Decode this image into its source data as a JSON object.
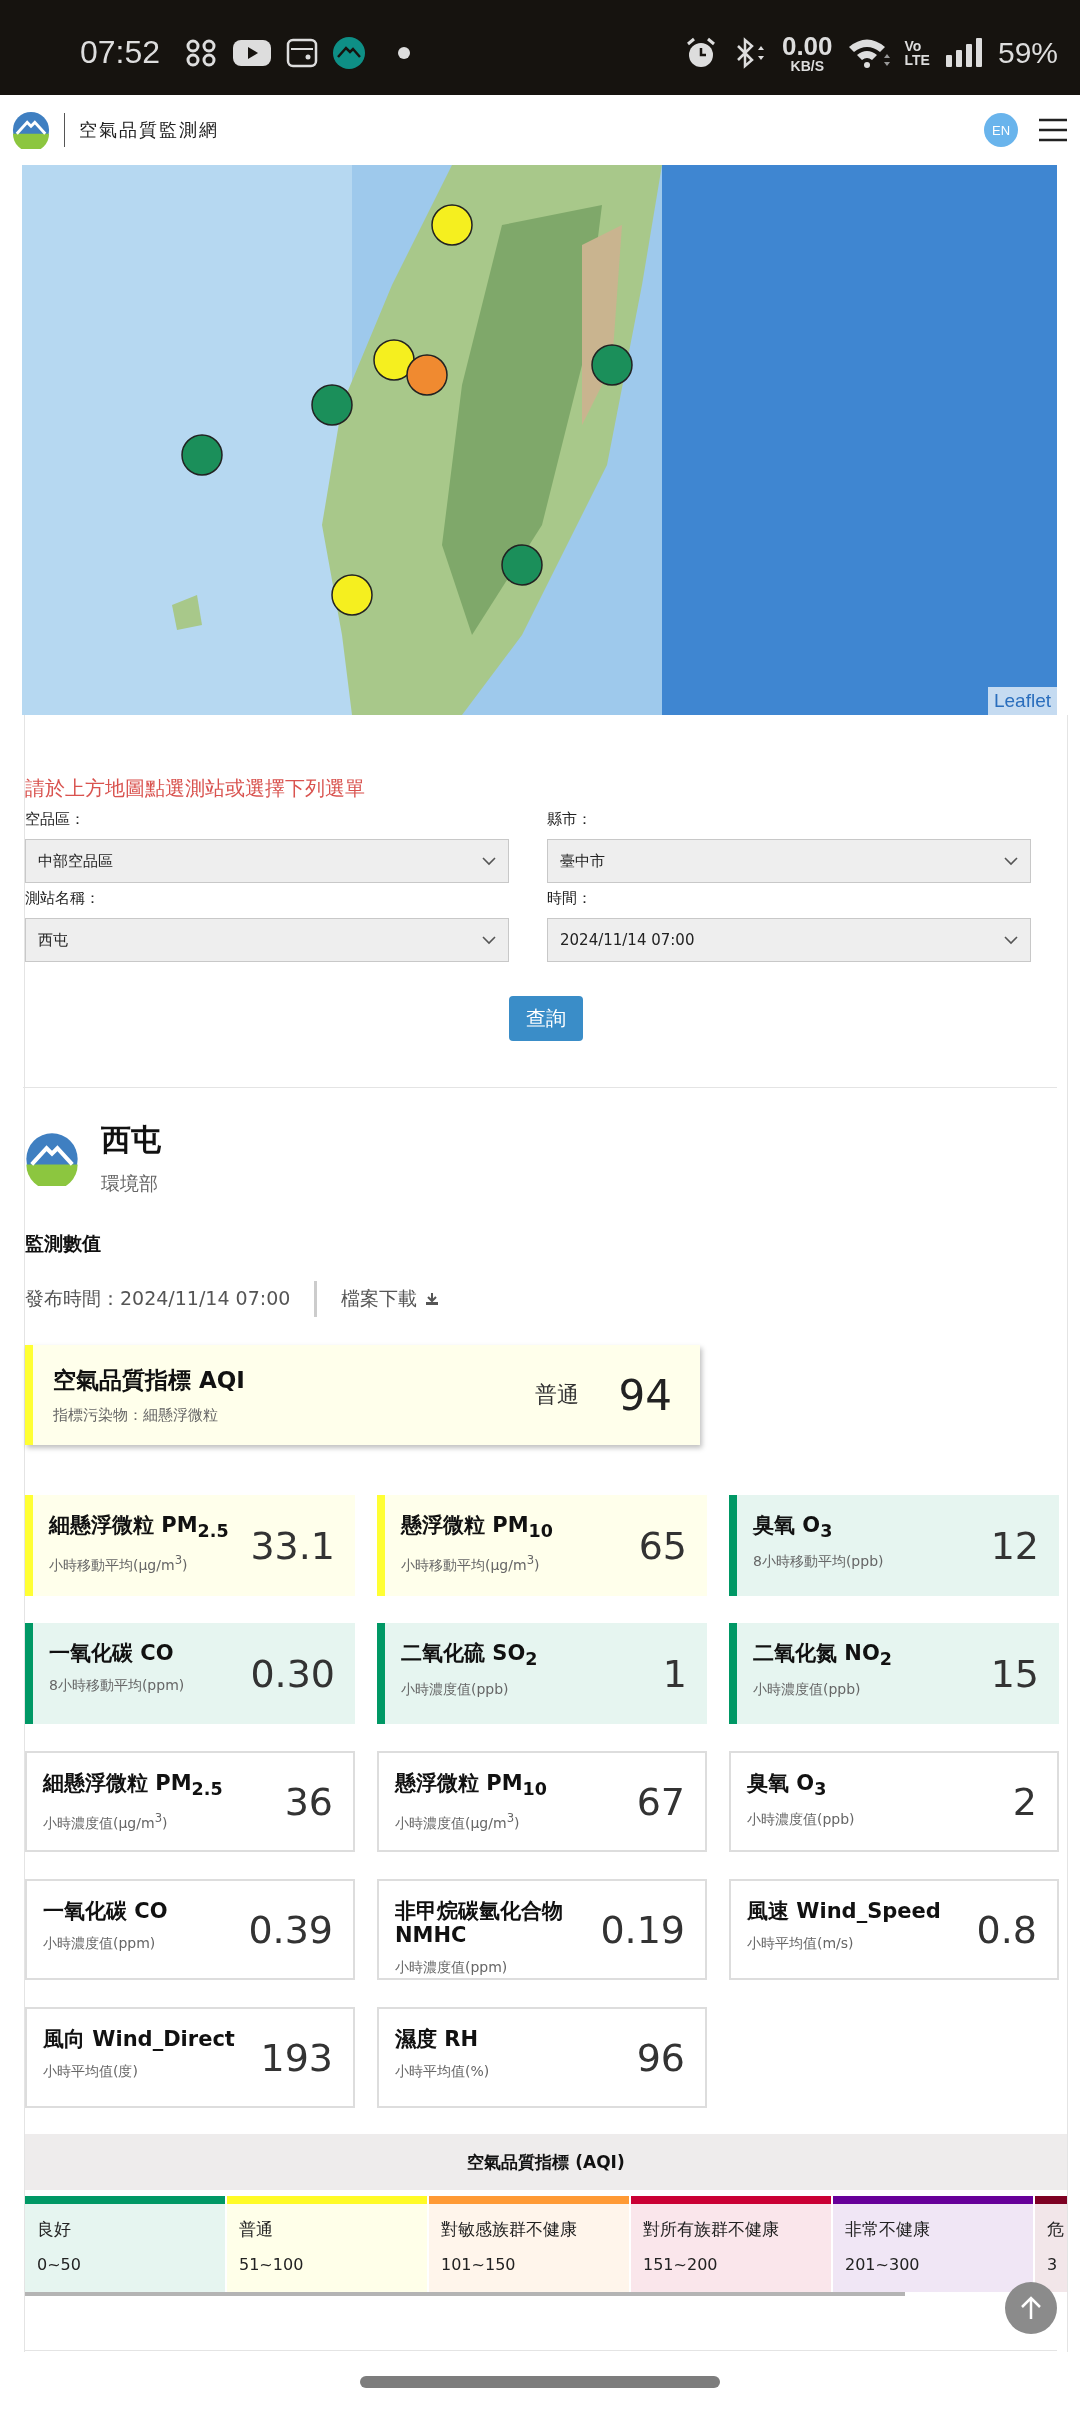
{
  "status_bar": {
    "time": "07:52",
    "net_speed": "0.00",
    "net_unit": "KB/S",
    "volte_top": "Vo",
    "volte_bottom": "LTE",
    "battery": "59%"
  },
  "header": {
    "site_name": "空氣品質監測網",
    "language": "EN"
  },
  "map": {
    "kind": "picture",
    "attribution": "Leaflet"
  },
  "query": {
    "prompt": "請於上方地圖點選測站或選擇下列選單",
    "fields": [
      {
        "label": "空品區：",
        "value": "中部空品區"
      },
      {
        "label": "縣市：",
        "value": "臺中市"
      },
      {
        "label": "測站名稱：",
        "value": "西屯"
      },
      {
        "label": "時間：",
        "value": "2024/11/14 07:00"
      }
    ],
    "button": "查詢"
  },
  "station": {
    "name": "西屯",
    "agency": "環境部",
    "section_title": "監測數值",
    "publish_time": "發布時間：2024/11/14 07:00",
    "download": "檔案下載"
  },
  "aqi": {
    "title": "空氣品質指標 AQI",
    "pollutant": "指標污染物：細懸浮微粒",
    "status": "普通",
    "value": "94",
    "color": "#ffff33"
  },
  "cards": [
    {
      "kind": "level",
      "color": "#ffff33",
      "name": "細懸浮微粒 PM$_{2.5}$",
      "unit": "小時移動平均(μg/m$^{3}$)",
      "value": "33.1"
    },
    {
      "kind": "level",
      "color": "#ffff33",
      "name": "懸浮微粒 PM$_{10}$",
      "unit": "小時移動平均(μg/m$^{3}$)",
      "value": "65"
    },
    {
      "kind": "level",
      "color": "#009865",
      "name": "臭氧 O$_{3}$",
      "unit": "8小時移動平均(ppb)",
      "value": "12"
    },
    {
      "kind": "level",
      "color": "#009865",
      "name": "一氧化碳 CO",
      "unit": "8小時移動平均(ppm)",
      "value": "0.30"
    },
    {
      "kind": "level",
      "color": "#009865",
      "name": "二氧化硫 SO$_{2}$",
      "unit": "小時濃度值(ppb)",
      "value": "1"
    },
    {
      "kind": "level",
      "color": "#009865",
      "name": "二氧化氮 NO$_{2}$",
      "unit": "小時濃度值(ppb)",
      "value": "15"
    },
    {
      "kind": "plain",
      "name": "細懸浮微粒 PM$_{2.5}$",
      "unit": "小時濃度值(μg/m$^{3}$)",
      "value": "36"
    },
    {
      "kind": "plain",
      "name": "懸浮微粒 PM$_{10}$",
      "unit": "小時濃度值(μg/m$^{3}$)",
      "value": "67"
    },
    {
      "kind": "plain",
      "name": "臭氧 O$_{3}$",
      "unit": "小時濃度值(ppb)",
      "value": "2"
    },
    {
      "kind": "plain",
      "name": "一氧化碳 CO",
      "unit": "小時濃度值(ppm)",
      "value": "0.39"
    },
    {
      "kind": "plain",
      "name": "非甲烷碳氫化合物 NMHC",
      "unit": "小時濃度值(ppm)",
      "value": "0.19"
    },
    {
      "kind": "plain",
      "name": "風速 Wind_Speed",
      "unit": "小時平均值(m/s)",
      "value": "0.8"
    },
    {
      "kind": "plain",
      "name": "風向 Wind_Direct",
      "unit": "小時平均值(度)",
      "value": "193"
    },
    {
      "kind": "plain",
      "name": "濕度 RH",
      "unit": "小時平均值(%)",
      "value": "96"
    }
  ],
  "legend": {
    "title": "空氣品質指標 (AQI)",
    "levels": [
      {
        "label": "良好",
        "range": "0~50",
        "color": "#009865"
      },
      {
        "label": "普通",
        "range": "51~100",
        "color": "#fffb26"
      },
      {
        "label": "對敏感族群不健康",
        "range": "101~150",
        "color": "#ff9a35"
      },
      {
        "label": "對所有族群不健康",
        "range": "151~200",
        "color": "#ca0034"
      },
      {
        "label": "非常不健康",
        "range": "201~300",
        "color": "#670099"
      },
      {
        "label": "危",
        "range": "3",
        "color": "#7e0123"
      }
    ]
  }
}
